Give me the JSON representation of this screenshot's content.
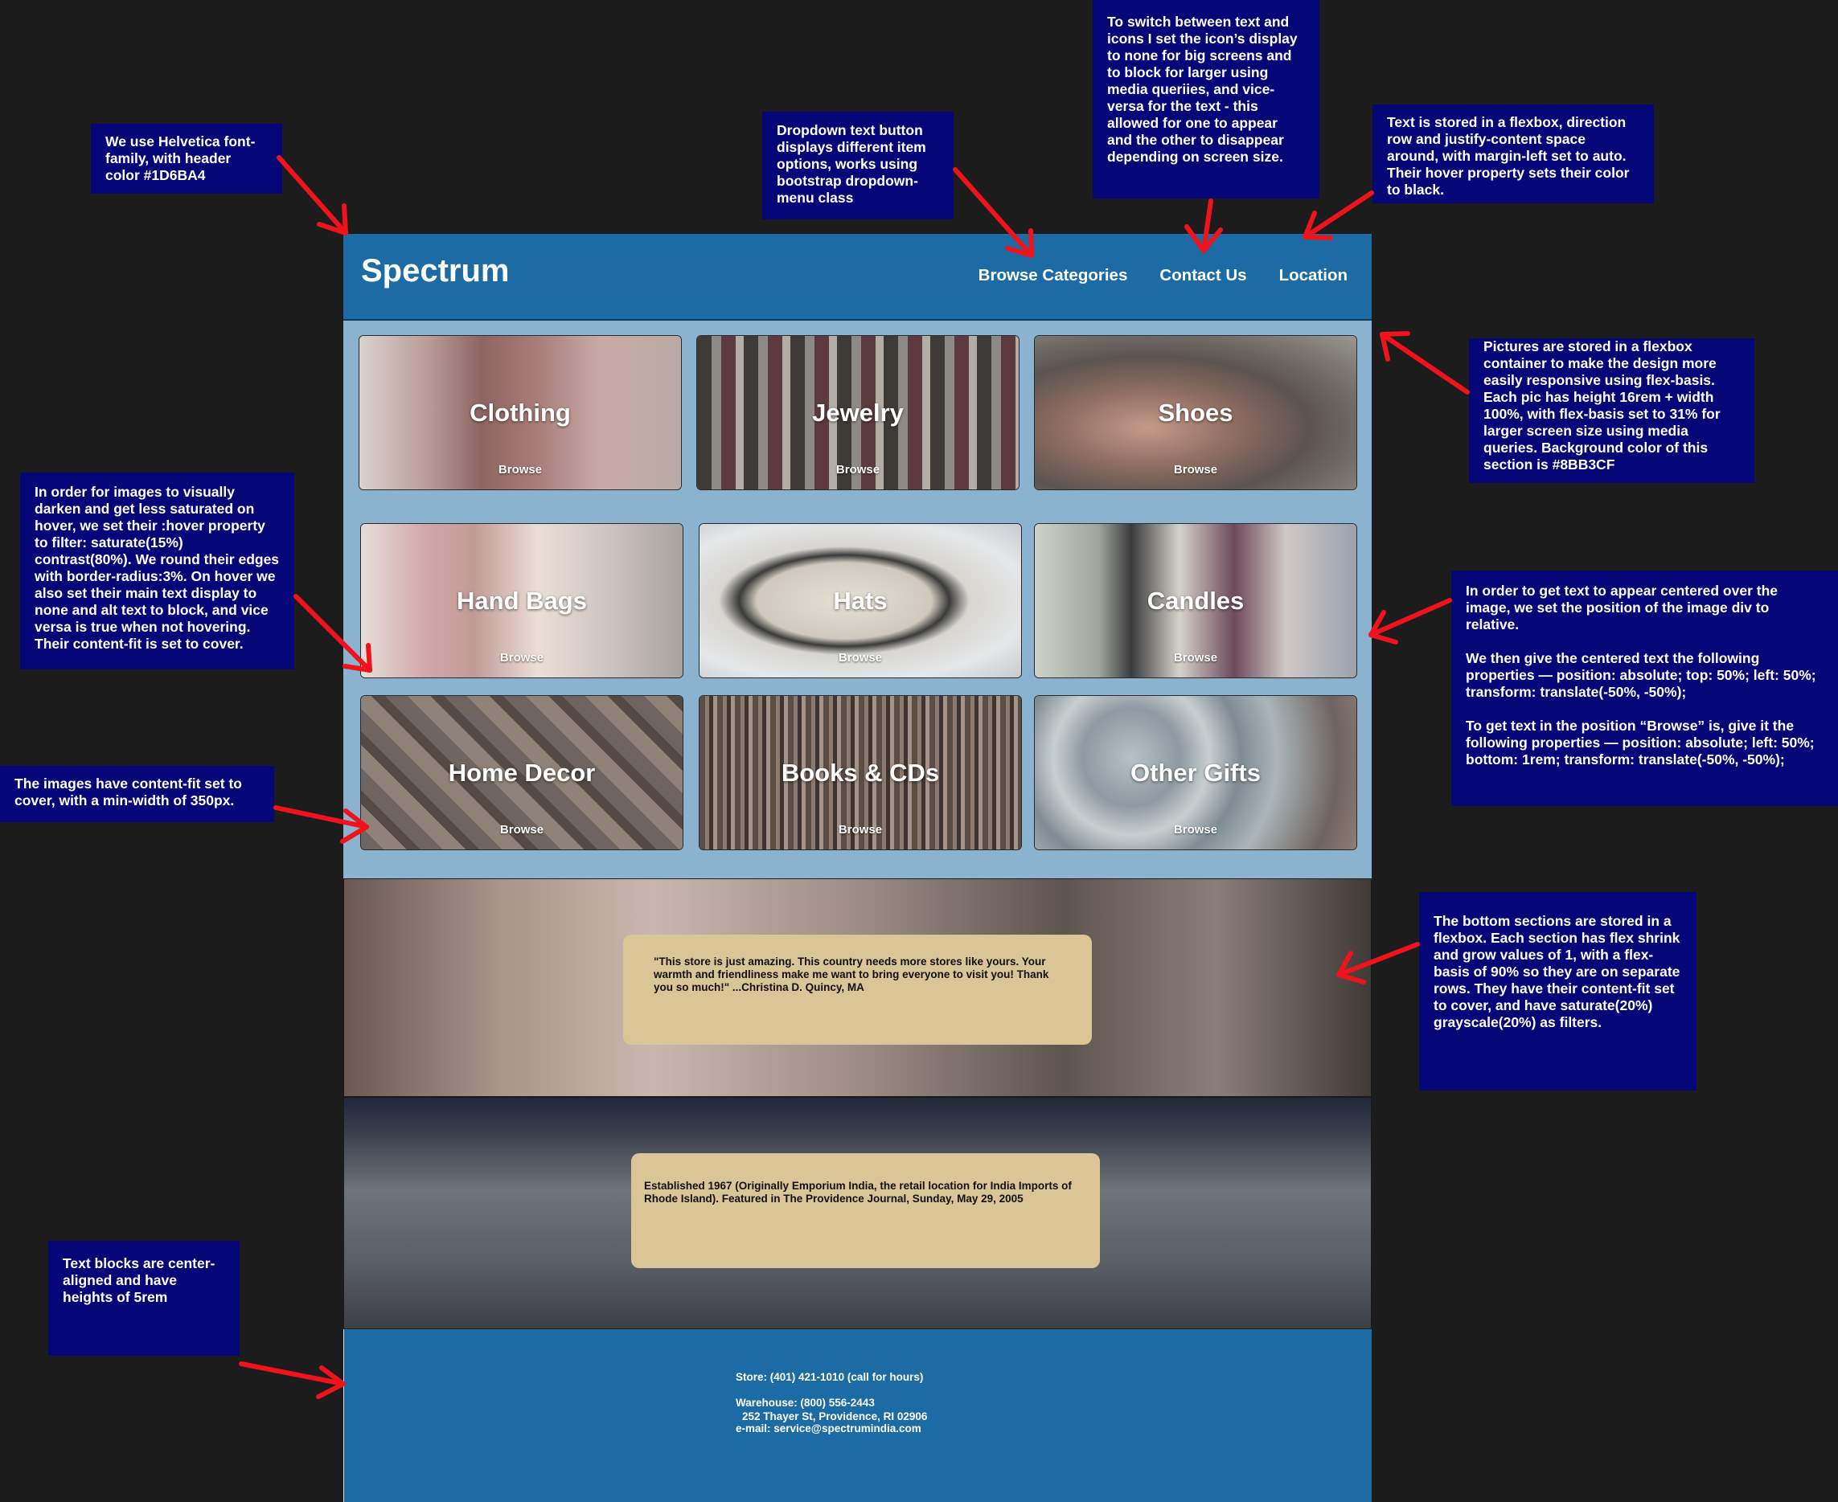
{
  "annotations": {
    "font": "We use Helvetica font-family, with header color #1D6BA4",
    "dropdown": "Dropdown text button displays different item options, works using bootstrap dropdown-menu class",
    "icons": "To switch between text and icons I set the icon’s display to none for big screens and to block for larger using media queriies, and vice-versa for the text - this allowed for one to appear and the other to disappear depending on screen size.",
    "flexbox_text": "Text is stored in a flexbox, direction row and justify-content space around, with margin-left set to auto. Their hover property sets their color to black.",
    "pictures": "Pictures are stored in a flexbox container to make the design more easily responsive using flex-basis. Each pic has height 16rem + width 100%, with flex-basis set to 31% for larger screen size using media queries. Background color of this section is #8BB3CF",
    "hover": "In order for images to visually darken and get less saturated on hover, we set their :hover property to filter: saturate(15%) contrast(80%). We round their edges with border-radius:3%. On hover we also set their main text display to none and alt text to block, and vice versa is true when not hovering. Their content-fit is set to cover.",
    "centered": "In order to get text to appear centered over the image, we set the position of the image div to relative.\n\nWe then give the centered text the following properties —  position: absolute; top: 50%; left: 50%; transform: translate(-50%, -50%);\n\nTo get text in the position “Browse” is, give it the following properties — position: absolute; left: 50%; bottom: 1rem; transform: translate(-50%, -50%);",
    "content_fit": "The images have content-fit set to cover, with a min-width of 350px.",
    "bottom_sections": "The bottom sections are stored in a flexbox. Each section has flex shrink and grow values of 1, with a flex-basis of 90% so they are on separate rows. They have their content-fit set to cover, and have saturate(20%) grayscale(20%) as filters.",
    "text_blocks": "Text blocks are center-aligned and have heights of 5rem"
  },
  "site": {
    "brand": "Spectrum",
    "nav": [
      "Browse Categories",
      "Contact Us",
      "Location"
    ],
    "browse_label": "Browse",
    "categories": [
      {
        "name": "Clothing",
        "image": "clothing-photo"
      },
      {
        "name": "Jewelry",
        "image": "bangles-photo"
      },
      {
        "name": "Shoes",
        "image": "sandals-photo"
      },
      {
        "name": "Hand Bags",
        "image": "handbag-photo"
      },
      {
        "name": "Hats",
        "image": "fedora-photo"
      },
      {
        "name": "Candles",
        "image": "candles-photo"
      },
      {
        "name": "Home Decor",
        "image": "pillow-photo"
      },
      {
        "name": "Books & CDs",
        "image": "bookshelf-photo"
      },
      {
        "name": "Other Gifts",
        "image": "pottery-photo"
      }
    ],
    "testimonial": "\"This store is just amazing. This country needs more stores like yours. Your warmth and friendliness make me want to bring everyone to visit you! Thank you so much!\" ...Christina D. Quincy, MA",
    "history": "Established 1967 (Originally Emporium India, the retail location for India Imports of Rhode Island). Featured in The Providence Journal, Sunday, May 29, 2005",
    "footer": {
      "store": "Store: (401) 421-1010 (call for hours)",
      "warehouse": "Warehouse: (800) 556-2443",
      "email": "e-mail: service@spectrumindia.com",
      "address": "252 Thayer St, Providence, RI 02906"
    }
  },
  "colors": {
    "header": "#1D6BA4",
    "section": "#8BB3CF",
    "note": "#050778",
    "arrow": "#F0131B",
    "quote": "#D9C596"
  }
}
